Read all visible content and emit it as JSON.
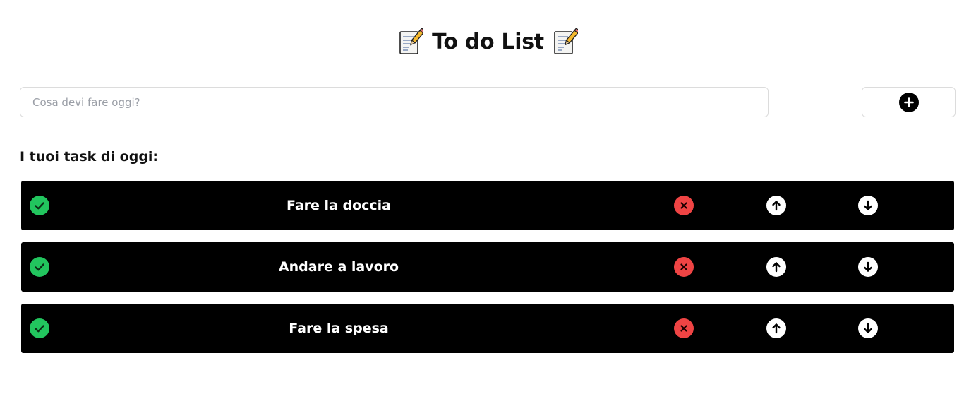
{
  "header": {
    "title": "To do List",
    "left_icon": "memo-icon",
    "right_icon": "memo-icon"
  },
  "new_task": {
    "placeholder": "Cosa devi fare oggi?",
    "value": "",
    "add_icon": "plus-circle-icon"
  },
  "list": {
    "heading": "I tuoi task di oggi:",
    "tasks": [
      {
        "text": "Fare la doccia"
      },
      {
        "text": "Andare a lavoro"
      },
      {
        "text": "Fare la spesa"
      }
    ],
    "row_icons": {
      "complete": "check-circle-icon",
      "delete": "x-circle-icon",
      "move_up": "arrow-up-circle-icon",
      "move_down": "arrow-down-circle-icon"
    }
  },
  "colors": {
    "row_background": "#000000",
    "complete": "#22c55e",
    "delete": "#ef4444",
    "arrows": "#ffffff",
    "add_button_icon": "#000000"
  }
}
